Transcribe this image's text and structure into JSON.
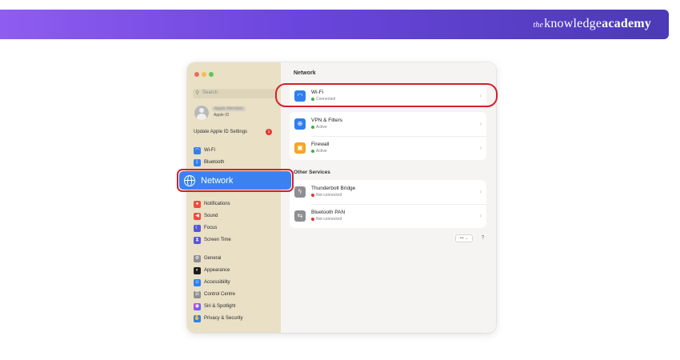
{
  "banner": {
    "brand_prefix": "the",
    "brand_main": "knowledge",
    "brand_bold": "academy"
  },
  "sidebar": {
    "search_placeholder": "Search",
    "account_name": "Apple Member",
    "account_sub": "Apple ID",
    "update_label": "Update Apple ID Settings",
    "update_badge": "1",
    "groups": [
      [
        {
          "label": "Wi-Fi",
          "icon": "wifi-icon"
        },
        {
          "label": "Bluetooth",
          "icon": "bluetooth-icon"
        }
      ],
      [
        {
          "label": "Network",
          "icon": "globe-icon",
          "selected": true
        }
      ],
      [
        {
          "label": "Notifications",
          "icon": "bell-icon"
        },
        {
          "label": "Sound",
          "icon": "speaker-icon"
        },
        {
          "label": "Focus",
          "icon": "moon-icon"
        },
        {
          "label": "Screen Time",
          "icon": "hourglass-icon"
        }
      ],
      [
        {
          "label": "General",
          "icon": "gear-icon"
        },
        {
          "label": "Appearance",
          "icon": "appearance-icon"
        },
        {
          "label": "Accessibility",
          "icon": "accessibility-icon"
        },
        {
          "label": "Control Centre",
          "icon": "control-centre-icon"
        },
        {
          "label": "Siri & Spotlight",
          "icon": "siri-icon"
        },
        {
          "label": "Privacy & Security",
          "icon": "hand-icon"
        }
      ]
    ]
  },
  "main": {
    "title": "Network",
    "wifi": {
      "title": "Wi-Fi",
      "status": "Connected"
    },
    "vpn": {
      "title": "VPN & Filters",
      "status": "Active"
    },
    "firewall": {
      "title": "Firewall",
      "status": "Active"
    },
    "other_heading": "Other Services",
    "thunderbolt": {
      "title": "Thunderbolt Bridge",
      "status": "Not connected"
    },
    "btpan": {
      "title": "Bluetooth PAN",
      "status": "Not connected"
    },
    "more_label": "•••",
    "help_label": "?"
  },
  "colors": {
    "accent": "#3b82f0",
    "highlight": "#d4202a",
    "banner_start": "#8f5cf0",
    "banner_end": "#4b3ab5",
    "connected": "#35b34a",
    "not_connected": "#e5362f"
  }
}
